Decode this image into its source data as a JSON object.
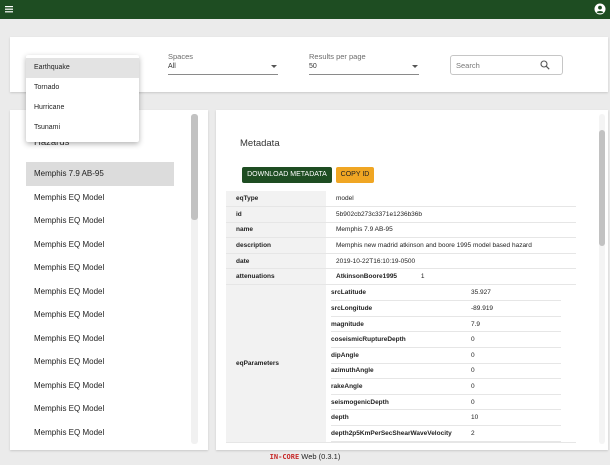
{
  "colors": {
    "appbar": "#1e4d22",
    "download_button": "#1e4d22",
    "copy_button": "#f0a623",
    "footer_brand": "#c62828"
  },
  "filters": {
    "spaces": {
      "label": "Spaces",
      "value": "All"
    },
    "results_per_page": {
      "label": "Results per page",
      "value": "50"
    },
    "search": {
      "placeholder": "Search"
    }
  },
  "dataset_menu": {
    "options": [
      "Earthquake",
      "Tornado",
      "Hurricane",
      "Tsunami"
    ],
    "selected_index": 0
  },
  "left_panel": {
    "title": "Hazards",
    "items": [
      "Memphis 7.9 AB-95",
      "Memphis EQ Model",
      "Memphis EQ Model",
      "Memphis EQ Model",
      "Memphis EQ Model",
      "Memphis EQ Model",
      "Memphis EQ Model",
      "Memphis EQ Model",
      "Memphis EQ Model",
      "Memphis EQ Model",
      "Memphis EQ Model",
      "Memphis EQ Model"
    ]
  },
  "metadata": {
    "title": "Metadata",
    "download_label": "DOWNLOAD METADATA",
    "copy_label": "COPY ID",
    "rows": [
      {
        "key": "eqType",
        "value": "model"
      },
      {
        "key": "id",
        "value": "5b902cb273c3371e1236b36b"
      },
      {
        "key": "name",
        "value": "Memphis 7.9 AB-95"
      },
      {
        "key": "description",
        "value": "Memphis new madrid atkinson and boore 1995 model based hazard"
      },
      {
        "key": "date",
        "value": "2019-10-22T16:10:19-0500"
      }
    ],
    "attenuations": {
      "key": "attenuations",
      "name": "AtkinsonBoore1995",
      "value": "1"
    },
    "eq_parameters": {
      "key": "eqParameters",
      "rows": [
        {
          "key": "srcLatitude",
          "value": "35.927"
        },
        {
          "key": "srcLongitude",
          "value": "-89.919"
        },
        {
          "key": "magnitude",
          "value": "7.9"
        },
        {
          "key": "coseismicRuptureDepth",
          "value": "0"
        },
        {
          "key": "dipAngle",
          "value": "0"
        },
        {
          "key": "azimuthAngle",
          "value": "0"
        },
        {
          "key": "rakeAngle",
          "value": "0"
        },
        {
          "key": "seismogenicDepth",
          "value": "0"
        },
        {
          "key": "depth",
          "value": "10"
        },
        {
          "key": "depth2p5KmPerSecShearWaveVelocity",
          "value": "2"
        }
      ]
    }
  },
  "footer": {
    "brand": "IN-CORE",
    "text": "Web (0.3.1)"
  }
}
